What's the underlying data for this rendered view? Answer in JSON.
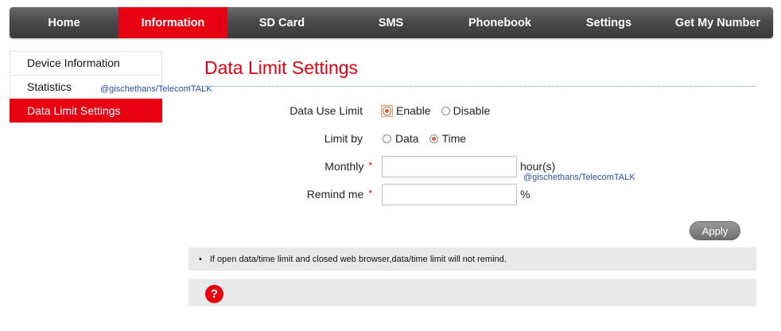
{
  "nav": {
    "tabs": [
      "Home",
      "Information",
      "SD Card",
      "SMS",
      "Phonebook",
      "Settings",
      "Get My Number"
    ],
    "active": "Information"
  },
  "sidebar": {
    "items": [
      "Device Information",
      "Statistics",
      "Data Limit Settings"
    ],
    "active": "Data Limit Settings"
  },
  "page": {
    "title": "Data Limit Settings"
  },
  "form": {
    "data_use_limit": {
      "label": "Data Use Limit",
      "options": [
        "Enable",
        "Disable"
      ],
      "selected": "Enable"
    },
    "limit_by": {
      "label": "Limit by",
      "options": [
        "Data",
        "Time"
      ],
      "selected": "Time"
    },
    "monthly": {
      "label": "Monthly",
      "required_mark": "*",
      "value": "",
      "unit": "hour(s)"
    },
    "remind_me": {
      "label": "Remind me",
      "required_mark": "*",
      "value": "",
      "unit": "%"
    },
    "apply_label": "Apply"
  },
  "note": {
    "bullet": "•",
    "text": "If open data/time limit and closed web browser,data/time limit will not remind."
  },
  "help": {
    "icon_text": "?"
  },
  "watermarks": [
    "@gischethans/TelecomTALK",
    "@gischethans/TelecomTALK"
  ],
  "colors": {
    "accent": "#e60012",
    "nav_bg": "#4a4a4a"
  }
}
